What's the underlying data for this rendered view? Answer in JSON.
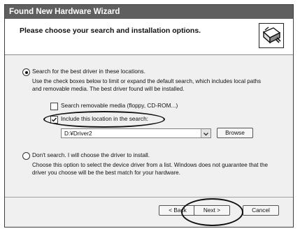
{
  "window": {
    "title": "Found New Hardware Wizard"
  },
  "header": {
    "title": "Please choose your search and installation options.",
    "icon": "hardware-install-icon"
  },
  "search_option": {
    "label": "Search for the best driver in these locations.",
    "selected": true,
    "description": "Use the check boxes below to limit or expand the default search, which includes local paths and removable media. The best driver found will be installed.",
    "removable_media": {
      "label": "Search removable media (floppy, CD-ROM...)",
      "checked": false
    },
    "include_location": {
      "label": "Include this location in the search:",
      "checked": true
    },
    "location_value": "D:¥Driver2",
    "browse_label": "Browse"
  },
  "manual_option": {
    "label": "Don't search. I will choose the driver to install.",
    "selected": false,
    "description": "Choose this option to select the device driver from a list.  Windows does not guarantee that the driver you choose will be the best match for your hardware."
  },
  "footer": {
    "back_label": "< Back",
    "next_label": "Next >",
    "cancel_label": "Cancel"
  },
  "colors": {
    "titlebar": "#5f5f5f",
    "dialog_bg": "#f0f0f0",
    "header_bg": "#ffffff",
    "highlight_outline": "#111111"
  }
}
